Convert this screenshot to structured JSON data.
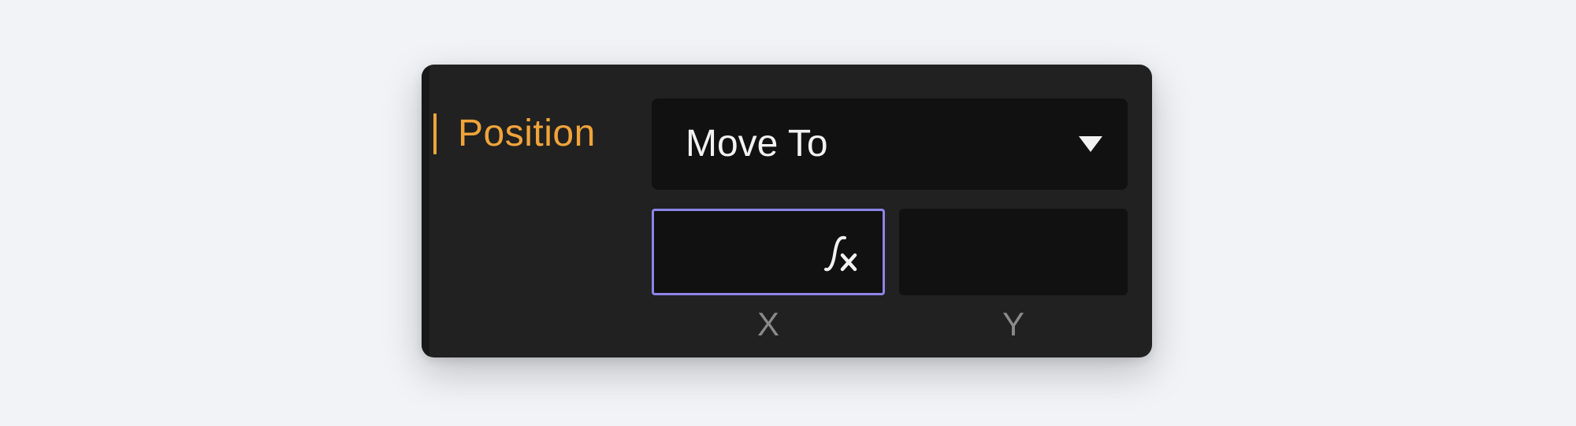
{
  "property": {
    "label": "Position",
    "accent_color": "#f0a43a"
  },
  "mode_select": {
    "value": "Move To",
    "caret_icon": "triangle-down-icon"
  },
  "fields": {
    "x": {
      "value": "",
      "label": "X",
      "focused": true,
      "focus_color": "#8d84e8",
      "expression_icon": "function-expression-icon"
    },
    "y": {
      "value": "",
      "label": "Y"
    }
  }
}
